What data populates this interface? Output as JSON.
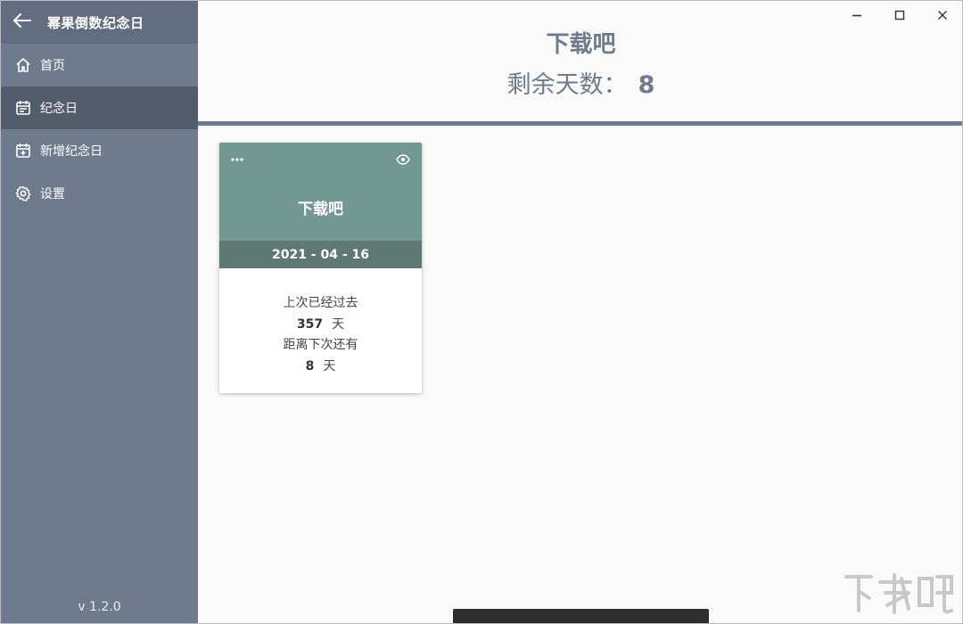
{
  "app": {
    "title": "幂果倒数纪念日",
    "version": "v 1.2.0"
  },
  "sidebar": {
    "items": [
      {
        "label": "首页",
        "icon": "home-icon",
        "active": false
      },
      {
        "label": "纪念日",
        "icon": "calendar-icon",
        "active": true
      },
      {
        "label": "新增纪念日",
        "icon": "calendar-add-icon",
        "active": false
      },
      {
        "label": "设置",
        "icon": "gear-icon",
        "active": false
      }
    ]
  },
  "banner": {
    "title": "下载吧",
    "remaining_label": "剩余天数：",
    "remaining_value": "8"
  },
  "card": {
    "title": "下载吧",
    "date": "2021 - 04 - 16",
    "passed_label": "上次已经过去",
    "passed_days": "357",
    "day_unit": "天",
    "next_label": "距离下次还有",
    "next_days": "8"
  },
  "colors": {
    "sidebar_bg": "#6e7b8d",
    "sidebar_active": "#525c6b",
    "card_top": "#739891",
    "card_date": "#5e7873",
    "accent_text": "#6e7b8d"
  }
}
